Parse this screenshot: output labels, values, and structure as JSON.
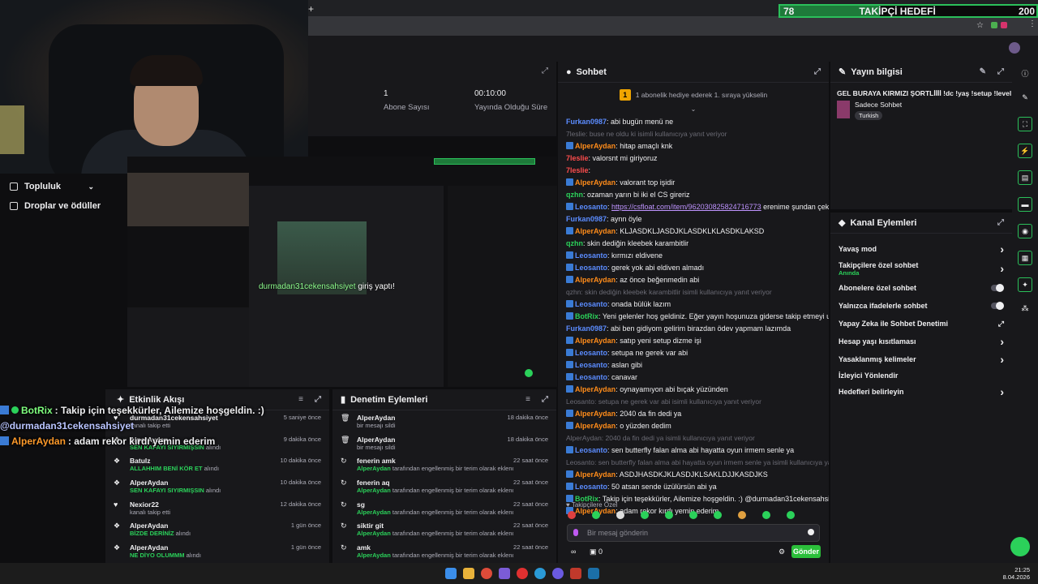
{
  "goal": {
    "current": "78",
    "label": "TAKİPÇİ HEDEFİ",
    "target": "200",
    "progress_fraction": 0.39,
    "accent": "#2bbf5a"
  },
  "nav": {
    "items": [
      {
        "label": "Topluluk"
      },
      {
        "label": "Droplar ve ödüller"
      }
    ]
  },
  "stats": {
    "abone_value": "1",
    "abone_label": "Abone Sayısı",
    "time_value": "00:10:00",
    "time_label": "Yayında Olduğu Süre"
  },
  "preview_overlay": {
    "text": "durmadan31cekensahsiyet",
    "suffix": "giriş yaptı!"
  },
  "chat": {
    "title": "Sohbet",
    "banner": "1 abonelik hediye ederek 1. sıraya yükselin",
    "banner_count": "1",
    "messages": [
      {
        "user": "Furkan0987",
        "color": "#5b8cff",
        "text": ": abi bugün menü ne"
      },
      {
        "sys": "7leslie: buse ne oldu ki isimli kullanıcıya yanıt veriyor"
      },
      {
        "user": "AlperAydan",
        "color": "#ff8c1a",
        "text": ": hitap amaçlı knk",
        "badge": true
      },
      {
        "user": "7leslie",
        "color": "#ff4d4d",
        "text": ": valorsnt mi giriyoruz"
      },
      {
        "user": "7leslie",
        "color": "#ff4d4d",
        "text": ":"
      },
      {
        "user": "AlperAydan",
        "color": "#ff8c1a",
        "text": ": valorant top işidir",
        "badge": true
      },
      {
        "user": "qzhn",
        "color": "#2bd15a",
        "text": ": ozaman yarın bi iki el CS gireriz"
      },
      {
        "user": "Leosanto",
        "color": "#5b8cff",
        "text": ": ",
        "link": "https://csfloat.com/item/962030825824716773",
        "tail": " erenime şundan çektik abi",
        "badge": true
      },
      {
        "user": "Furkan0987",
        "color": "#5b8cff",
        "text": ": aynn öyle"
      },
      {
        "user": "AlperAydan",
        "color": "#ff8c1a",
        "text": ": KLJASDKLJASDJKLASDKLKLASDKLAKSD",
        "badge": true
      },
      {
        "user": "qzhn",
        "color": "#2bd15a",
        "text": ": skin dediğin kleebek karambitlir"
      },
      {
        "user": "Leosanto",
        "color": "#5b8cff",
        "text": ": kırmızı eldivene",
        "badge": true
      },
      {
        "user": "Leosanto",
        "color": "#5b8cff",
        "text": ": gerek yok abi eldiven almadı",
        "badge": true
      },
      {
        "user": "AlperAydan",
        "color": "#ff8c1a",
        "text": ": az önce beğenmedin abi",
        "badge": true
      },
      {
        "sys": "qzhn: skin dediğin kleebek karambitlir isimli kullanıcıya yanıt veriyor"
      },
      {
        "user": "Leosanto",
        "color": "#5b8cff",
        "text": ": onada bülük lazım",
        "badge": true
      },
      {
        "user": "BotRix",
        "color": "#2bd15a",
        "text": ": Yeni gelenler hoş geldiniz. Eğer yayın hoşunuza giderse takip etmeyi unutmayın :)",
        "badge": true
      },
      {
        "user": "Furkan0987",
        "color": "#5b8cff",
        "text": ": abi ben gidiyom gelirim birazdan ödev yapmam lazımda"
      },
      {
        "user": "AlperAydan",
        "color": "#ff8c1a",
        "text": ": satıp yeni setup dizme işi",
        "badge": true
      },
      {
        "user": "Leosanto",
        "color": "#5b8cff",
        "text": ": setupa ne gerek var abi",
        "badge": true
      },
      {
        "user": "Leosanto",
        "color": "#5b8cff",
        "text": ": aslan gibi",
        "badge": true
      },
      {
        "user": "Leosanto",
        "color": "#5b8cff",
        "text": ": canavar",
        "badge": true
      },
      {
        "user": "AlperAydan",
        "color": "#ff8c1a",
        "text": ": oynayamıyon abi bıçak yüzünden",
        "badge": true
      },
      {
        "sys": "Leosanto: setupa ne gerek var abi isimli kullanıcıya yanıt veriyor"
      },
      {
        "user": "AlperAydan",
        "color": "#ff8c1a",
        "text": ": 2040 da fin dedi ya",
        "badge": true
      },
      {
        "user": "AlperAydan",
        "color": "#ff8c1a",
        "text": ": o yüzden dedim",
        "badge": true
      },
      {
        "sys": "AlperAydan: 2040 da fin dedi ya isimli kullanıcıya yanıt veriyor"
      },
      {
        "user": "Leosanto",
        "color": "#5b8cff",
        "text": ": sen butterfly falan alma abi hayatta oyun irmem senle ya",
        "badge": true
      },
      {
        "sys": "Leosanto: sen butterfly falan alma abi hayatta oyun irmem senle ya isimli kullanıcıya yanıt veriyor"
      },
      {
        "user": "AlperAydan",
        "color": "#ff8c1a",
        "text": ": ASDJHASDKJKLASDJKLSAKLDJJKASDJKS",
        "badge": true
      },
      {
        "user": "Leosanto",
        "color": "#5b8cff",
        "text": ": 50 atsan sende üzülürsün abi ya",
        "badge": true
      },
      {
        "user": "BotRix",
        "color": "#2bd15a",
        "text": ": Takip için teşekkürler, Ailemize hoşgeldin. :) @durmadan31cekensahsiyet",
        "badge": true
      },
      {
        "user": "AlperAydan",
        "color": "#ff8c1a",
        "text": ": adam rekor kırdı yemin ederim",
        "badge": true
      }
    ],
    "followers_only": "Takipçilere Özel",
    "input_placeholder": "Bir mesaj gönderin",
    "viewers": "0",
    "send_label": "Gönder"
  },
  "stream_info": {
    "title": "Yayın bilgisi",
    "stream_title": "GEL BURAYA KIRMIZI ŞORTLİİİİ !dc !yaş !setup !level",
    "category": "Sadece Sohbet",
    "tag": "Turkish"
  },
  "channel_actions": {
    "title": "Kanal Eylemleri",
    "rows": [
      {
        "label": "Yavaş mod",
        "type": "arrow"
      },
      {
        "label": "Takipçilere özel sohbet",
        "sub": "Anında",
        "type": "arrow"
      },
      {
        "label": "Abonelere özel sohbet",
        "type": "toggle"
      },
      {
        "label": "Yalnızca ifadelerle sohbet",
        "type": "toggle"
      },
      {
        "label": "Yapay Zeka ile Sohbet Denetimi",
        "type": "ext"
      },
      {
        "label": "Hesap yaşı kısıtlaması",
        "type": "arrow"
      },
      {
        "label": "Yasaklanmış kelimeler",
        "type": "arrow"
      },
      {
        "label": "İzleyici Yönlendir",
        "type": "none"
      },
      {
        "label": "Hedefleri belirleyin",
        "type": "arrow"
      }
    ]
  },
  "activity": {
    "title": "Etkinlik Akışı",
    "items": [
      {
        "icon": "♥",
        "name": "durmadan31cekensahsiyet",
        "desc": "kanalı takip etti",
        "time": "5 saniye önce"
      },
      {
        "icon": "❖",
        "name": "AlperAydan",
        "desc": "SEN KAFAYI SIYIRMIŞSIN",
        "desc2": " alındı",
        "time": "9 dakika önce"
      },
      {
        "icon": "❖",
        "name": "Batulz",
        "desc": "ALLAHHIM BENİ KÖR ET",
        "desc2": " alındı",
        "time": "10 dakika önce"
      },
      {
        "icon": "❖",
        "name": "AlperAydan",
        "desc": "SEN KAFAYI SIYIRMIŞSIN",
        "desc2": " alındı",
        "time": "10 dakika önce"
      },
      {
        "icon": "♥",
        "name": "Nexior22",
        "desc": "kanalı takip etti",
        "time": "12 dakika önce"
      },
      {
        "icon": "❖",
        "name": "AlperAydan",
        "desc": "BİZDE DERİNİZ",
        "desc2": " alındı",
        "time": "1 gün önce"
      },
      {
        "icon": "❖",
        "name": "AlperAydan",
        "desc": "NE DİYO OLUMMM",
        "desc2": " alındı",
        "time": "1 gün önce"
      }
    ]
  },
  "moderation": {
    "title": "Denetim Eylemleri",
    "items": [
      {
        "icon": "🗑",
        "name": "AlperAydan",
        "desc": "bir mesajı sildi",
        "time": "18 dakika önce"
      },
      {
        "icon": "🗑",
        "name": "AlperAydan",
        "desc": "bir mesajı sildi",
        "time": "18 dakika önce"
      },
      {
        "icon": "↻",
        "name": "fenerin amk",
        "desc_user": "AlperAydan",
        "desc": " tarafından engellenmiş bir terim olarak eklendi",
        "time": "22 saat önce"
      },
      {
        "icon": "↻",
        "name": "fenerin aq",
        "desc_user": "AlperAydan",
        "desc": " tarafından engellenmiş bir terim olarak eklendi",
        "time": "22 saat önce"
      },
      {
        "icon": "↻",
        "name": "sg",
        "desc_user": "AlperAydan",
        "desc": " tarafından engellenmiş bir terim olarak eklendi",
        "time": "22 saat önce"
      },
      {
        "icon": "↻",
        "name": "siktir git",
        "desc_user": "AlperAydan",
        "desc": " tarafından engellenmiş bir terim olarak eklendi",
        "time": "22 saat önce"
      },
      {
        "icon": "↻",
        "name": "amk",
        "desc_user": "AlperAydan",
        "desc": " tarafından engellenmiş bir terim olarak eklendi",
        "time": "22 saat önce"
      }
    ]
  },
  "overlay": {
    "line1_user": "BotRix",
    "line1_text": ": Takip için teşekkürler, Ailemize hoşgeldin. :)",
    "line2": "@durmadan31cekensahsiyet",
    "line3_user": "AlperAydan",
    "line3_text": ": adam rekor kırdı yemin ederim"
  },
  "taskbar": {
    "time": "21:25",
    "date": "8.04.2026"
  }
}
